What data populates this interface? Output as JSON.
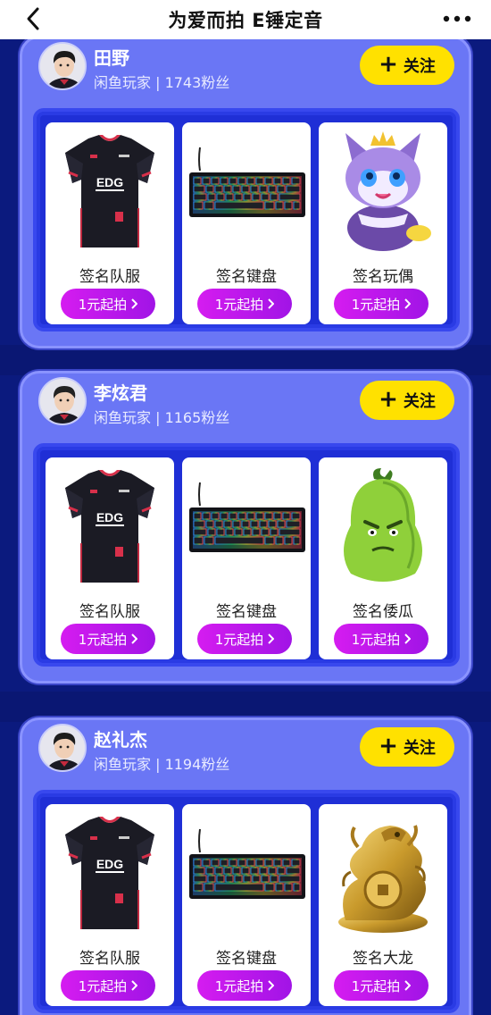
{
  "header": {
    "title": "为爱而拍 E锤定音",
    "back_icon": "chevron-left-icon",
    "more_icon": "more-dots-icon"
  },
  "players": [
    {
      "name": "田野",
      "subtitle": "闲鱼玩家 | 1743粉丝",
      "follow_label": "关注",
      "items": [
        {
          "name": "签名队服",
          "bid_label": "1元起拍",
          "icon": "jersey"
        },
        {
          "name": "签名键盘",
          "bid_label": "1元起拍",
          "icon": "keyboard"
        },
        {
          "name": "签名玩偶",
          "bid_label": "1元起拍",
          "icon": "cat-plush"
        }
      ]
    },
    {
      "name": "李炫君",
      "subtitle": "闲鱼玩家 | 1165粉丝",
      "follow_label": "关注",
      "items": [
        {
          "name": "签名队服",
          "bid_label": "1元起拍",
          "icon": "jersey"
        },
        {
          "name": "签名键盘",
          "bid_label": "1元起拍",
          "icon": "keyboard"
        },
        {
          "name": "签名倭瓜",
          "bid_label": "1元起拍",
          "icon": "squash-plush"
        }
      ]
    },
    {
      "name": "赵礼杰",
      "subtitle": "闲鱼玩家 | 1194粉丝",
      "follow_label": "关注",
      "items": [
        {
          "name": "签名队服",
          "bid_label": "1元起拍",
          "icon": "jersey"
        },
        {
          "name": "签名键盘",
          "bid_label": "1元起拍",
          "icon": "keyboard"
        },
        {
          "name": "签名大龙",
          "bid_label": "1元起拍",
          "icon": "dragon-statue"
        }
      ]
    }
  ],
  "colors": {
    "background": "#0b1a7e",
    "card": "#6a76f5",
    "panel": "#1f2fd6",
    "follow": "#ffe100",
    "bid": "#c41aee"
  }
}
